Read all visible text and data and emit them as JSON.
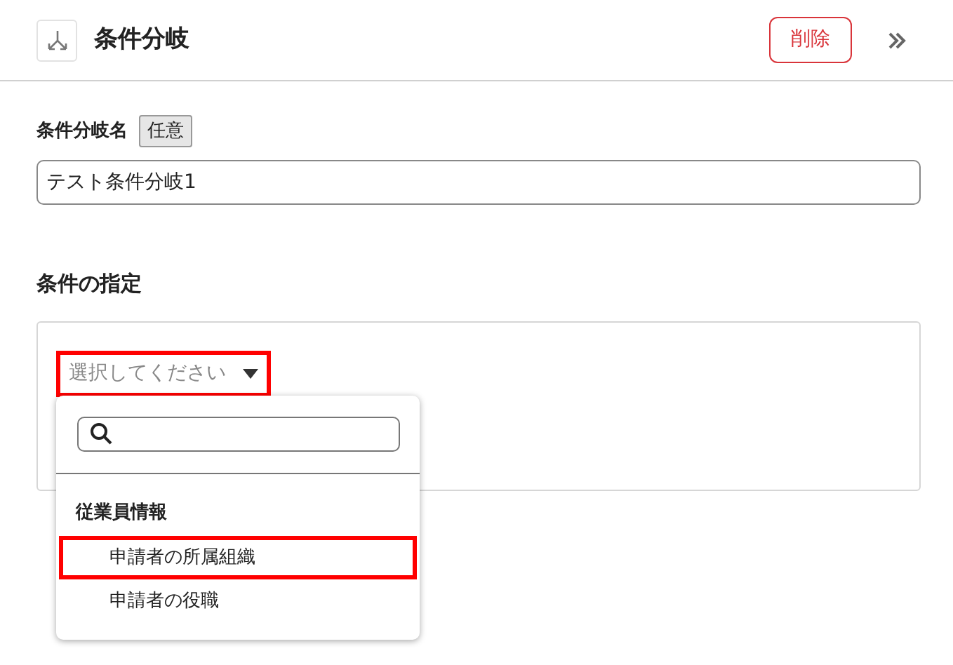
{
  "header": {
    "title": "条件分岐",
    "delete_button": "削除"
  },
  "name_field": {
    "label": "条件分岐名",
    "badge": "任意",
    "value": "テスト条件分岐1"
  },
  "condition": {
    "heading": "条件の指定",
    "dropdown": {
      "placeholder": "選択してください",
      "highlighted": true,
      "expanded": true,
      "groups": [
        {
          "label": "従業員情報",
          "options": [
            {
              "label": "申請者の所属組織",
              "highlighted": true
            },
            {
              "label": "申請者の役職",
              "highlighted": false
            }
          ]
        }
      ]
    }
  }
}
